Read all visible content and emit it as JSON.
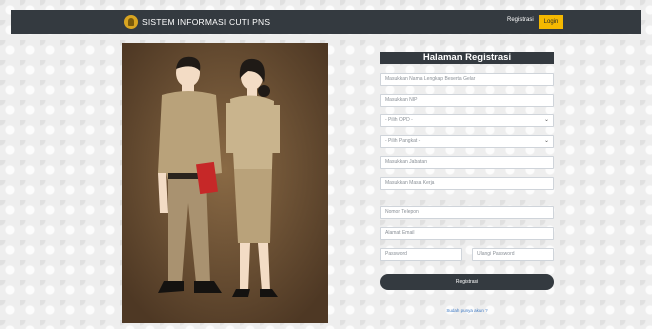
{
  "navbar": {
    "title": "SISTEM INFORMASI CUTI PNS",
    "register_label": "Registrasi",
    "login_label": "Login"
  },
  "form": {
    "title": "Halaman Registrasi",
    "fields": {
      "nama": "Masukkan Nama Lengkap Beserta Gelar",
      "nip": "Masukkan NIP",
      "opd": "- Pilih OPD -",
      "pangkat": "- Pilih Pangkat -",
      "jabatan": "Masukkan Jabatan",
      "masa_kerja": "Masukkan Masa Kerja",
      "telepon": "Nomor Telepon",
      "email": "Alamat Email",
      "password": "Password",
      "ulangi_password": "Ulangi Password"
    },
    "submit_label": "Registrasi",
    "login_link": "Sudah punya akun ?"
  },
  "colors": {
    "navbar": "#343a40",
    "accent": "#f5b800",
    "link": "#3b78c4"
  }
}
